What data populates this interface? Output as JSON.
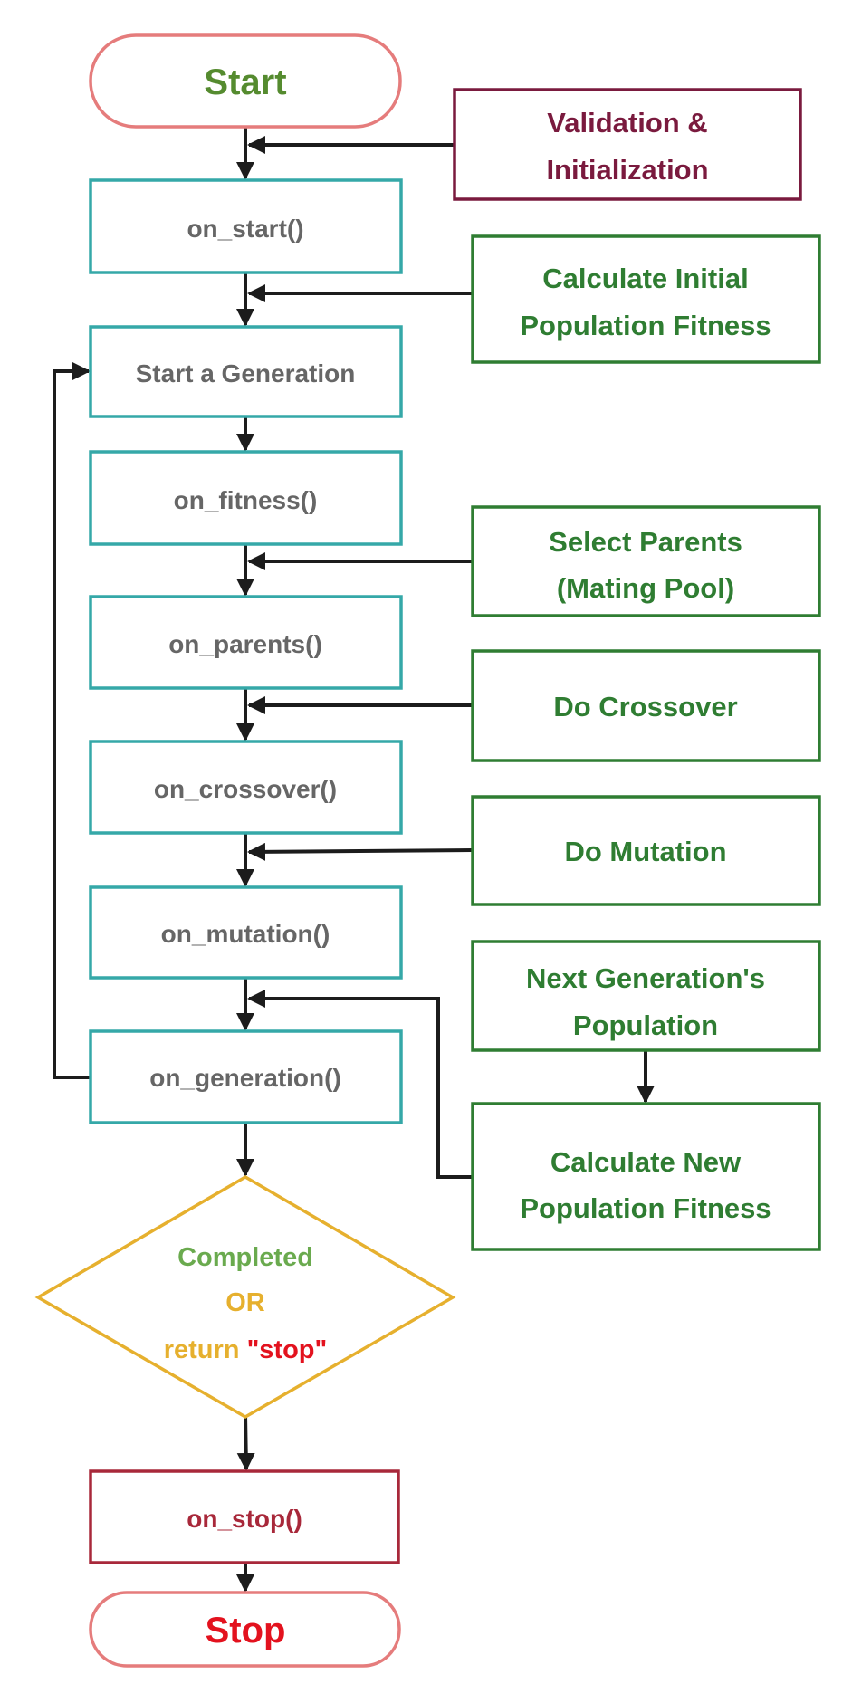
{
  "colors": {
    "terminal_border": "#e57c7c",
    "start_text": "#558b2f",
    "stop_text": "#e3121e",
    "hook_border": "#35a8a8",
    "hook_text": "#666666",
    "action_border": "#2f7d32",
    "action_text": "#2f7d32",
    "init_border": "#7a1a3e",
    "init_text": "#7a1a3e",
    "decision_border": "#e6b02e",
    "decision_completed": "#6aaa4e",
    "decision_or": "#e6b02e",
    "decision_stop": "#e3121e",
    "stop_hook_border": "#a8283a",
    "stop_hook_text": "#a8283a",
    "arrow": "#1c1c1c"
  },
  "nodes": {
    "start": "Start",
    "on_start": "on_start()",
    "start_generation": "Start a Generation",
    "on_fitness": "on_fitness()",
    "on_parents": "on_parents()",
    "on_crossover": "on_crossover()",
    "on_mutation": "on_mutation()",
    "on_generation": "on_generation()",
    "on_stop": "on_stop()",
    "stop": "Stop"
  },
  "actions": {
    "validation": [
      "Validation &",
      "Initialization"
    ],
    "calc_initial": [
      "Calculate Initial",
      "Population Fitness"
    ],
    "select_parents": [
      "Select Parents",
      "(Mating Pool)"
    ],
    "crossover": [
      "Do Crossover"
    ],
    "mutation": [
      "Do Mutation"
    ],
    "next_generation": [
      "Next Generation's",
      "Population"
    ],
    "calc_new": [
      "Calculate New",
      "Population Fitness"
    ]
  },
  "decision": {
    "line1": "Completed",
    "line2": "OR",
    "line3_a": "return",
    "line3_b": "\"stop\""
  }
}
